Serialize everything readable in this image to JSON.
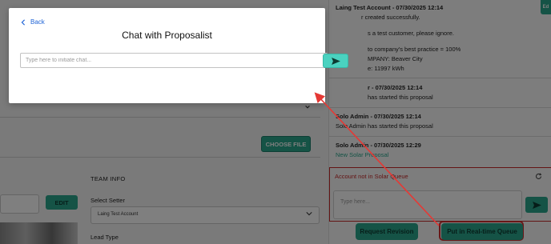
{
  "modal": {
    "back_label": "Back",
    "title": "Chat with Proposalist",
    "chat_placeholder": "Type here to initiate chat..."
  },
  "left": {
    "choose_file_label": "CHOOSE FILE",
    "team_info_label": "TEAM INFO",
    "edit_label": "EDIT",
    "select_setter_label": "Select Setter",
    "setter_value": "Laing Test Account",
    "lead_type_label": "Lead Type"
  },
  "right": {
    "messages": [
      {
        "line1": "Laing Test Account - 07/30/2025 12:14",
        "line2": "r created successfully.",
        "line3": "s a test customer, please ignore.",
        "line4": "to company's best practice = 100%",
        "line5": "MPANY: Beaver City",
        "line6": "e: 11997 kWh"
      },
      {
        "author": "r - 07/30/2025 12:14",
        "text": "has started this proposal"
      },
      {
        "author": "Solo Admin - 07/30/2025 12:14",
        "text": "Solo Admin has started this proposal"
      },
      {
        "author": "Solo Admin - 07/30/2025 12:29",
        "text": "New Solar Proposal"
      }
    ],
    "queue_status": "Account not in Solar Queue",
    "type_placeholder": "Type here...",
    "request_revision_label": "Request Revision",
    "realtime_queue_label": "Put in Real-time Queue",
    "side_tab_label": "Ed"
  },
  "icons": {
    "back": "chevron-left-icon",
    "send": "send-icon",
    "refresh": "refresh-icon",
    "dropdown": "chevron-down-icon"
  },
  "colors": {
    "accent": "#2aa78c",
    "send_button": "#4ad2c0",
    "alert_red": "#c62828",
    "link_blue": "#1e63d6"
  }
}
